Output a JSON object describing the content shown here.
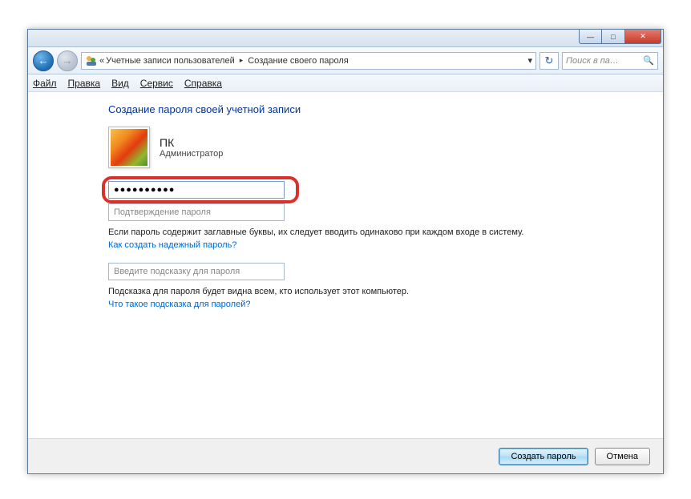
{
  "titlebar": {
    "min": "—",
    "max": "□",
    "close": "✕"
  },
  "nav": {
    "back": "←",
    "fwd": "→",
    "refresh": "↻"
  },
  "breadcrumb": {
    "prefix": "«",
    "seg1": "Учетные записи пользователей",
    "seg2": "Создание своего пароля",
    "chev": "▸",
    "dropdown": "▾"
  },
  "search": {
    "placeholder": "Поиск в па…",
    "icon": "🔍"
  },
  "menu": {
    "file": "Файл",
    "edit": "Правка",
    "view": "Вид",
    "tools": "Сервис",
    "help": "Справка"
  },
  "page": {
    "title": "Создание пароля своей учетной записи",
    "user_name": "ПК",
    "user_role": "Администратор",
    "password_value": "●●●●●●●●●●",
    "confirm_placeholder": "Подтверждение пароля",
    "caps_info": "Если пароль содержит заглавные буквы, их следует вводить одинаково при каждом входе в систему.",
    "strong_link": "Как создать надежный пароль?",
    "hint_placeholder": "Введите подсказку для пароля",
    "hint_info": "Подсказка для пароля будет видна всем, кто использует этот компьютер.",
    "hint_link": "Что такое подсказка для паролей?"
  },
  "footer": {
    "create": "Создать пароль",
    "cancel": "Отмена"
  }
}
